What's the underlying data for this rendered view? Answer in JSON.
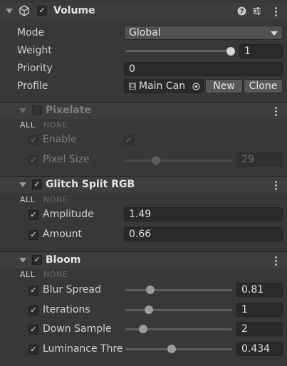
{
  "component": {
    "title": "Volume",
    "enabled_mark": "✓",
    "help_icon": "help-icon",
    "preset_icon": "preset-icon",
    "menu_icon": "kebab-icon",
    "fields": {
      "mode_label": "Mode",
      "mode_value": "Global",
      "weight_label": "Weight",
      "weight_value": "1",
      "weight_fraction": 1.0,
      "priority_label": "Priority",
      "priority_value": "0",
      "profile_label": "Profile",
      "profile_value": "Main Can",
      "new_button": "New",
      "clone_button": "Clone"
    }
  },
  "overrides": [
    {
      "title": "Pixelate",
      "enabled": false,
      "all_label": "ALL",
      "none_label": "NONE",
      "rows": [
        {
          "label": "Enable",
          "kind": "checkbox",
          "checked": true
        },
        {
          "label": "Pixel Size",
          "kind": "slider",
          "value": "29",
          "fraction": 0.28
        }
      ]
    },
    {
      "title": "Glitch Split RGB",
      "enabled": true,
      "all_label": "ALL",
      "none_label": "NONE",
      "rows": [
        {
          "label": "Amplitude",
          "kind": "field",
          "value": "1.49"
        },
        {
          "label": "Amount",
          "kind": "field",
          "value": "0.66"
        }
      ]
    },
    {
      "title": "Bloom",
      "enabled": true,
      "all_label": "ALL",
      "none_label": "NONE",
      "rows": [
        {
          "label": "Blur Spread",
          "kind": "slider",
          "value": "0.81",
          "fraction": 0.24
        },
        {
          "label": "Iterations",
          "kind": "slider",
          "value": "1",
          "fraction": 0.22
        },
        {
          "label": "Down Sample",
          "kind": "slider",
          "value": "2",
          "fraction": 0.17
        },
        {
          "label": "Luminance Thre",
          "kind": "slider",
          "value": "0.434",
          "fraction": 0.43
        }
      ]
    }
  ],
  "colors": {
    "background": "#383838",
    "header": "#3e3e3e",
    "field": "#2a2a2a",
    "text": "#d2d2d2",
    "disabled_text": "#7e7e7e"
  }
}
